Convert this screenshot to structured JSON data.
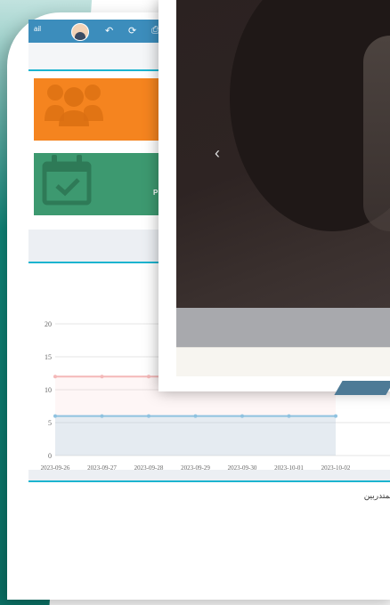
{
  "topbar": {
    "user_fragment": "ail",
    "icons": [
      "avatar",
      "undo-icon",
      "refresh-icon",
      "print-icon"
    ]
  },
  "tiles": {
    "green_text": "P"
  },
  "chart_data": {
    "type": "line",
    "title": "",
    "xlabel": "",
    "ylabel": "",
    "categories": [
      "2023-09-26",
      "2023-09-27",
      "2023-09-28",
      "2023-09-29",
      "2023-09-30",
      "2023-10-01",
      "2023-10-02"
    ],
    "ylim": [
      0,
      20
    ],
    "yticks": [
      "0",
      "5",
      "10",
      "15",
      "20"
    ],
    "series": [
      {
        "values": [
          12,
          12,
          12,
          12,
          12,
          12,
          12
        ],
        "color": "#f4b8b8"
      },
      {
        "values": [
          6,
          6,
          6,
          6,
          6,
          6,
          6
        ],
        "color": "#8fc2e0"
      }
    ],
    "grid": true
  },
  "list": {
    "title": "تقييم المتدربين"
  },
  "modal": {
    "prev_glyph": "‹"
  },
  "colors": {
    "topbar": "#3c8dbc",
    "orange": "#f5841f",
    "green": "#3d9970",
    "accent": "#1cb4cf"
  }
}
